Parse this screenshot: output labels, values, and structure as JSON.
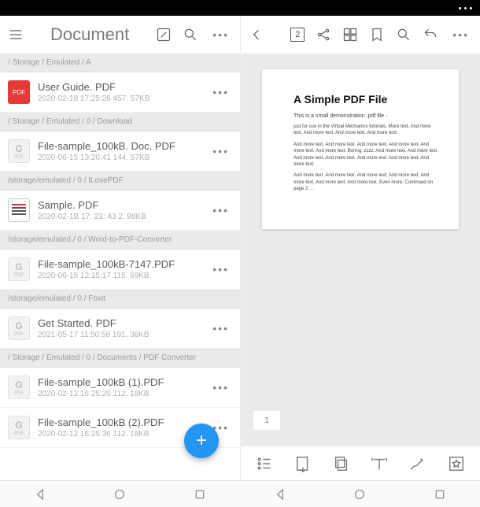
{
  "leftPanel": {
    "title": "Document",
    "sections": [
      {
        "path": "/ Storage / Emulated / A",
        "files": [
          {
            "name": "User Guide. PDF",
            "meta": "2020-02-18 17:25:26 457. 57KB",
            "iconType": "red"
          }
        ]
      },
      {
        "path": "/ Storage / Emulated / 0 / Download",
        "files": [
          {
            "name": "File-sample_100kB. Doc. PDF",
            "meta": "2020-06-15 13:20:41 144. 57KB",
            "iconType": "gray"
          }
        ]
      },
      {
        "path": "/storage/emulated / 0 / ILovePDF",
        "files": [
          {
            "name": "Sample. PDF",
            "meta": "2020-02-1B 17: 23: 43 2. 98KB",
            "iconType": "white"
          }
        ]
      },
      {
        "path": "/storage/emulated / 0 / Word-to-PDF-Converter",
        "files": [
          {
            "name": "File-sample_100kB-7147.PDF",
            "meta": "2020-06-15 12:15:17 115. 69KB",
            "iconType": "gray"
          }
        ]
      },
      {
        "path": "/storage/emulated / 0 / Foxit",
        "files": [
          {
            "name": "Get Started. PDF",
            "meta": "2021-05-17 11:50:58 191. 38KB",
            "iconType": "gray"
          }
        ]
      },
      {
        "path": "/ Storage / Emulated / 0 / Documents / PDF Converter",
        "files": [
          {
            "name": "File-sample_100kB (1).PDF",
            "meta": "2020-02-12 16:25:20 112. 18KB",
            "iconType": "gray"
          },
          {
            "name": "File-sample_100kB (2).PDF",
            "meta": "2020-02-12 16:25:36 112. 18KB",
            "iconType": "gray"
          }
        ]
      }
    ]
  },
  "rightPanel": {
    "pageNumber": "2",
    "pageTab": "1",
    "doc": {
      "title": "A Simple PDF File",
      "subtitle": "This is a small demonstration .pdf file -",
      "para1": "just for use in the Virtual Mechanics tutorials. More text. And more text. And more text. And more text. And more text.",
      "para2": "And more text. And more text. And more text. And more text. And more text. And more text. Boring, zzzz. And more text. And more text. And more text. And more text. And more text. And more text. And more text.",
      "para3": "And more text. And more text. And more text. And more text. And more text. And more text. And more text. Even more. Continued on page 2 ..."
    }
  }
}
